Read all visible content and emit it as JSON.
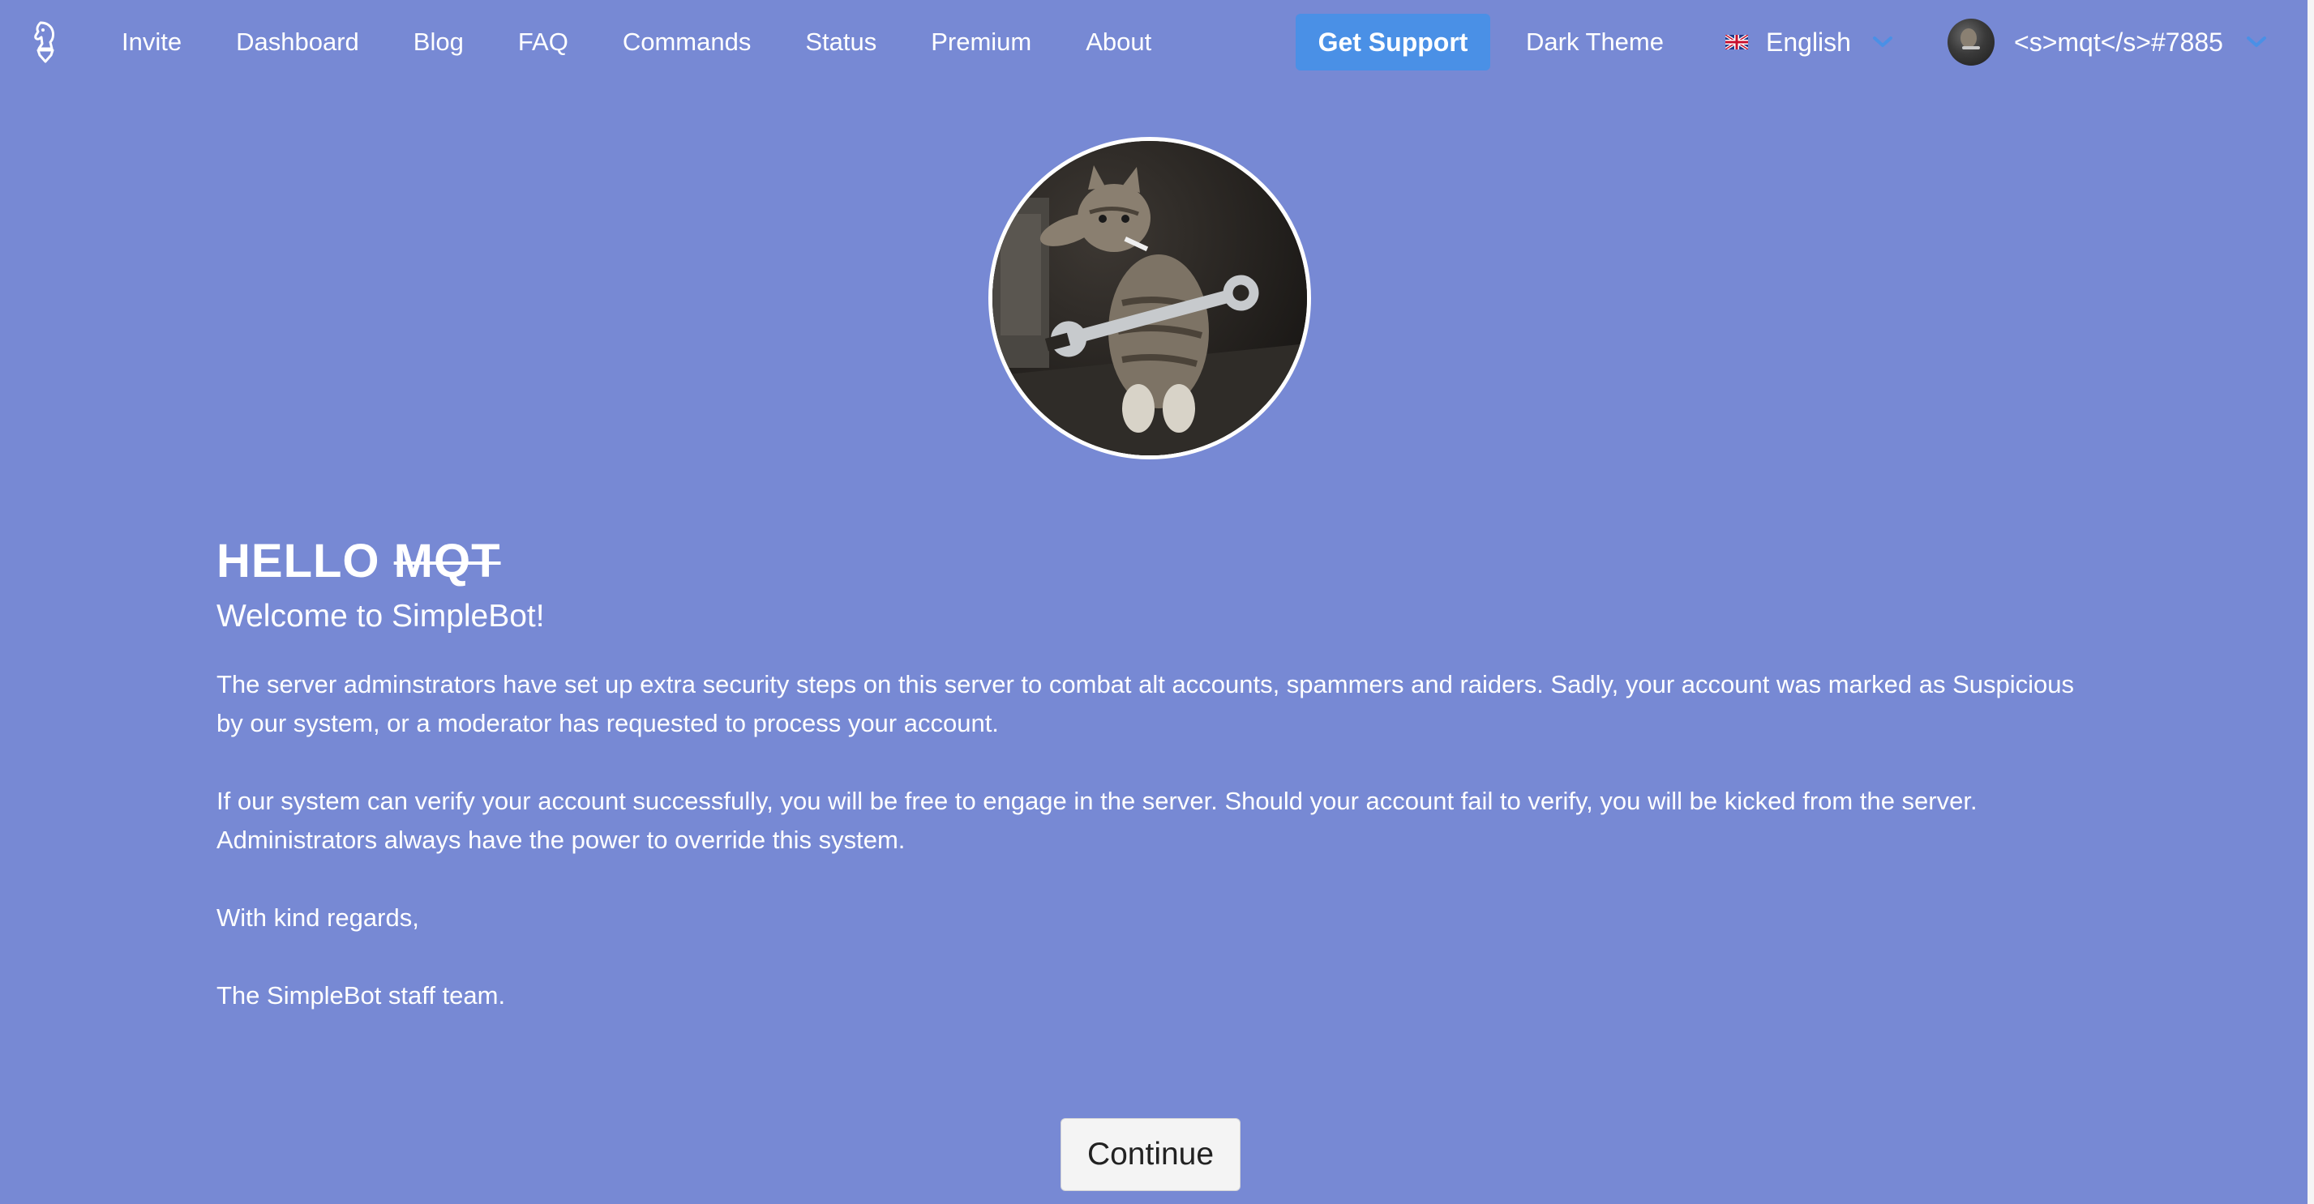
{
  "theme": {
    "background": "#7789d4",
    "support_button": "#4a90e6",
    "chevron": "#4a90e6",
    "text": "#ffffff"
  },
  "navbar": {
    "logo_icon": "chess-knight-logo-icon",
    "links": [
      "Invite",
      "Dashboard",
      "Blog",
      "FAQ",
      "Commands",
      "Status",
      "Premium",
      "About"
    ],
    "support_label": "Get Support",
    "theme_label": "Dark Theme",
    "language": {
      "flag_icon": "uk-flag-icon",
      "label": "English"
    },
    "user": {
      "label": "<s>mqt</s>#7885"
    }
  },
  "main": {
    "hello_word": "HELLO",
    "hello_name": "MQT",
    "welcome": "Welcome to SimpleBot!",
    "paragraph_1": "The server adminstrators have set up extra security steps on this server to combat alt accounts, spammers and raiders. Sadly, your account was marked as Suspicious by our system, or a moderator has requested to process your account.",
    "paragraph_2": "If our system can verify your account successfully, you will be free to engage in the server. Should your account fail to verify, you will be kicked from the server. Administrators always have the power to override this system.",
    "closing": "With kind regards,",
    "signature": "The SimpleBot staff team.",
    "continue_label": "Continue"
  }
}
